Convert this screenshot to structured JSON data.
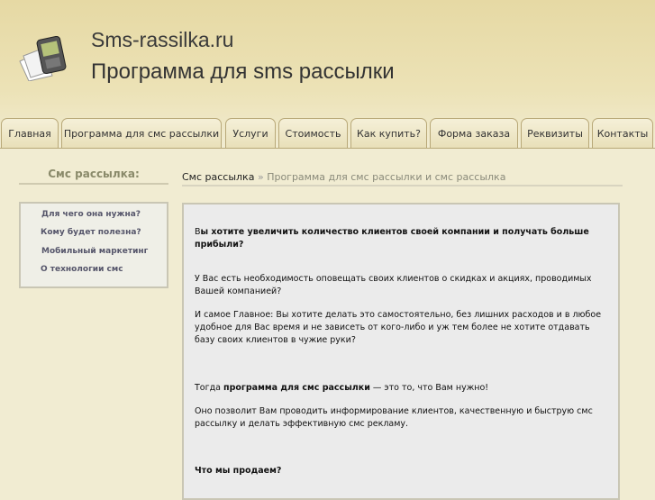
{
  "header": {
    "site_name": "Sms-rassilka.ru",
    "tagline": "Программа для sms рассылки"
  },
  "nav": {
    "tabs": [
      {
        "label": "Главная"
      },
      {
        "label": "Программа для смс рассылки"
      },
      {
        "label": "Услуги"
      },
      {
        "label": "Стоимость"
      },
      {
        "label": "Как купить?"
      },
      {
        "label": "Форма заказа"
      },
      {
        "label": "Реквизиты"
      },
      {
        "label": "Контакты"
      }
    ]
  },
  "sidebar": {
    "title": "Смс рассылка:",
    "items": [
      {
        "label": "Для чего она нужна?"
      },
      {
        "label": "Кому будет полезна?"
      },
      {
        "label": "Мобильный маркетинг"
      },
      {
        "label": "О технологии смс"
      }
    ]
  },
  "breadcrumb": {
    "home": "Смс рассылка",
    "separator": " » ",
    "current": "Программа для смс рассылки и смс рассылка"
  },
  "content": {
    "p1_first": "В",
    "p1_rest": "ы хотите увеличить количество клиентов своей компании и получать больше прибыли?",
    "p2": "У Вас есть необходимость оповещать своих клиентов о скидках и акциях, проводимых Вашей компанией?",
    "p3": "И самое Главное: Вы хотите делать это самостоятельно, без лишних расходов и в любое удобное для Вас время и не зависеть от кого-либо и уж тем более не хотите отдавать базу своих клиентов в чужие руки?",
    "p4_pre": "Тогда ",
    "p4_bold": "программа для смс рассылки",
    "p4_post": " — это то, что Вам нужно!",
    "p5": "Оно позволит Вам проводить информирование клиентов, качественную и быструю смс рассылку и делать эффективную смс рекламу.",
    "h_sell": "Что мы продаем?"
  }
}
